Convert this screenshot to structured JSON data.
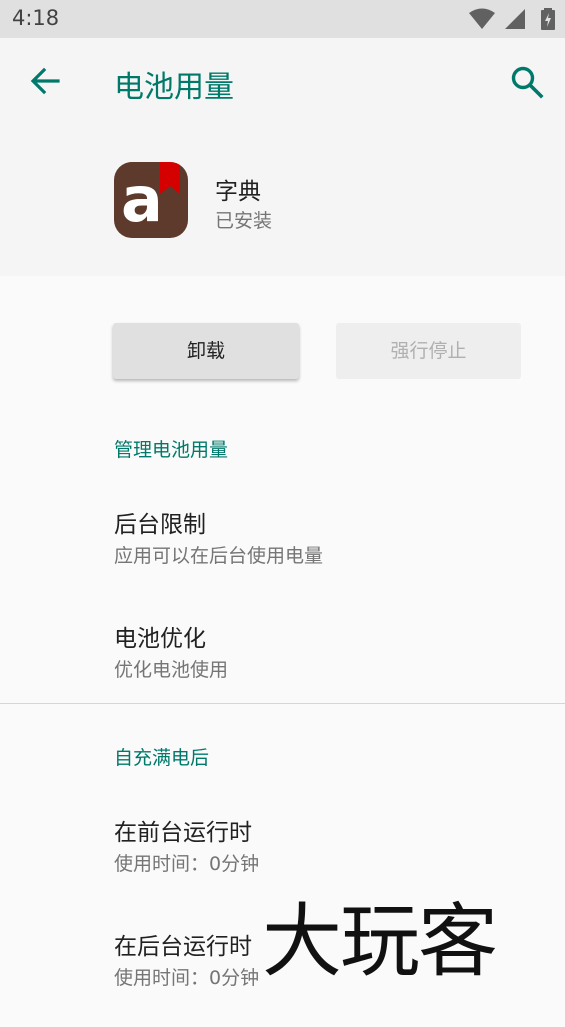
{
  "status_bar": {
    "time": "4:18",
    "icons": [
      "wifi-icon",
      "signal-icon",
      "battery-icon"
    ]
  },
  "app_bar": {
    "title": "电池用量",
    "back_icon": "arrow-left-icon",
    "search_icon": "search-icon",
    "accent_color": "#00796b"
  },
  "app_header": {
    "app_name": "字典",
    "app_status": "已安装",
    "icon_letter": "a",
    "icon_bg_color": "#5d3a2c",
    "ribbon_color": "#d50000"
  },
  "actions": {
    "uninstall_label": "卸载",
    "force_stop_label": "强行停止",
    "force_stop_enabled": false
  },
  "sections": [
    {
      "title": "管理电池用量",
      "items": [
        {
          "title": "后台限制",
          "summary": "应用可以在后台使用电量"
        },
        {
          "title": "电池优化",
          "summary": "优化电池使用"
        }
      ]
    },
    {
      "title": "自充满电后",
      "items": [
        {
          "title": "在前台运行时",
          "summary": "使用时间：0分钟"
        },
        {
          "title": "在后台运行时",
          "summary": "使用时间：0分钟"
        }
      ]
    }
  ],
  "watermark": {
    "text": "大玩客"
  }
}
